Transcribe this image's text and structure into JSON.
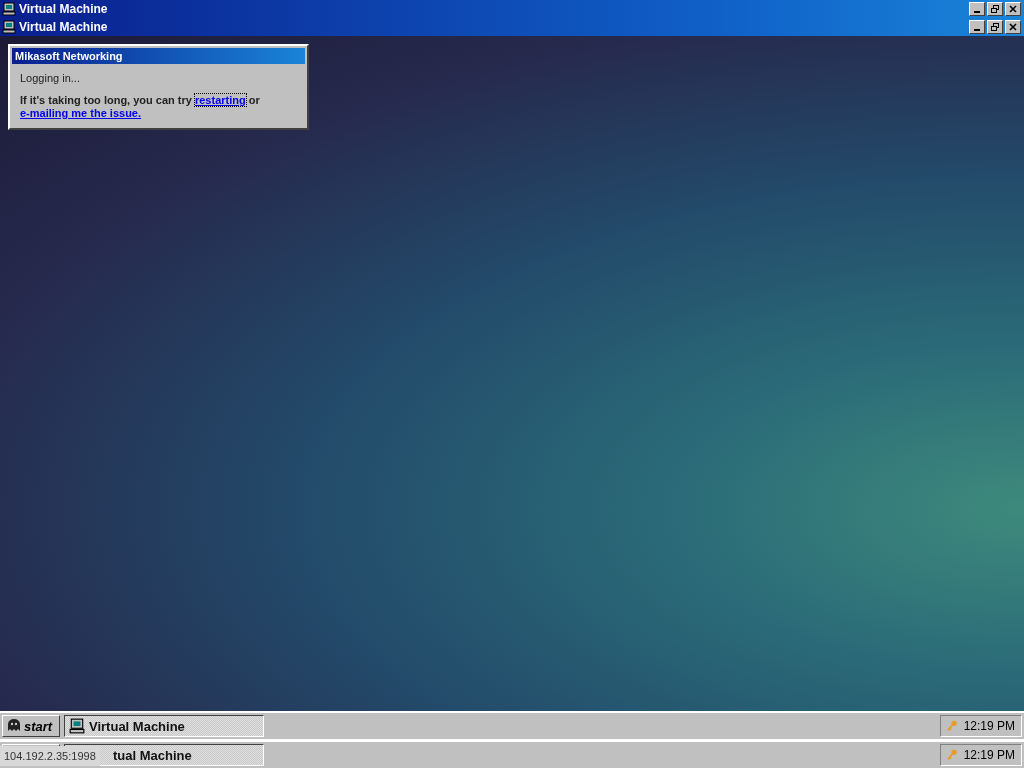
{
  "title_bars": [
    {
      "title": "Virtual Machine"
    },
    {
      "title": "Virtual Machine"
    }
  ],
  "dialog": {
    "title": "Mikasoft Networking",
    "status": "Logging in...",
    "message_before": "If it's taking too long, you can try",
    "link_restart": "restarting",
    "message_middle": "or",
    "link_email": "e-mailing me the issue."
  },
  "taskbars": [
    {
      "start_label": "start",
      "task": "Virtual Machine",
      "clock": "12:19 PM"
    },
    {
      "task": "tual Machine",
      "clock": "12:19 PM"
    }
  ],
  "tooltip": "104.192.2.35:1998"
}
